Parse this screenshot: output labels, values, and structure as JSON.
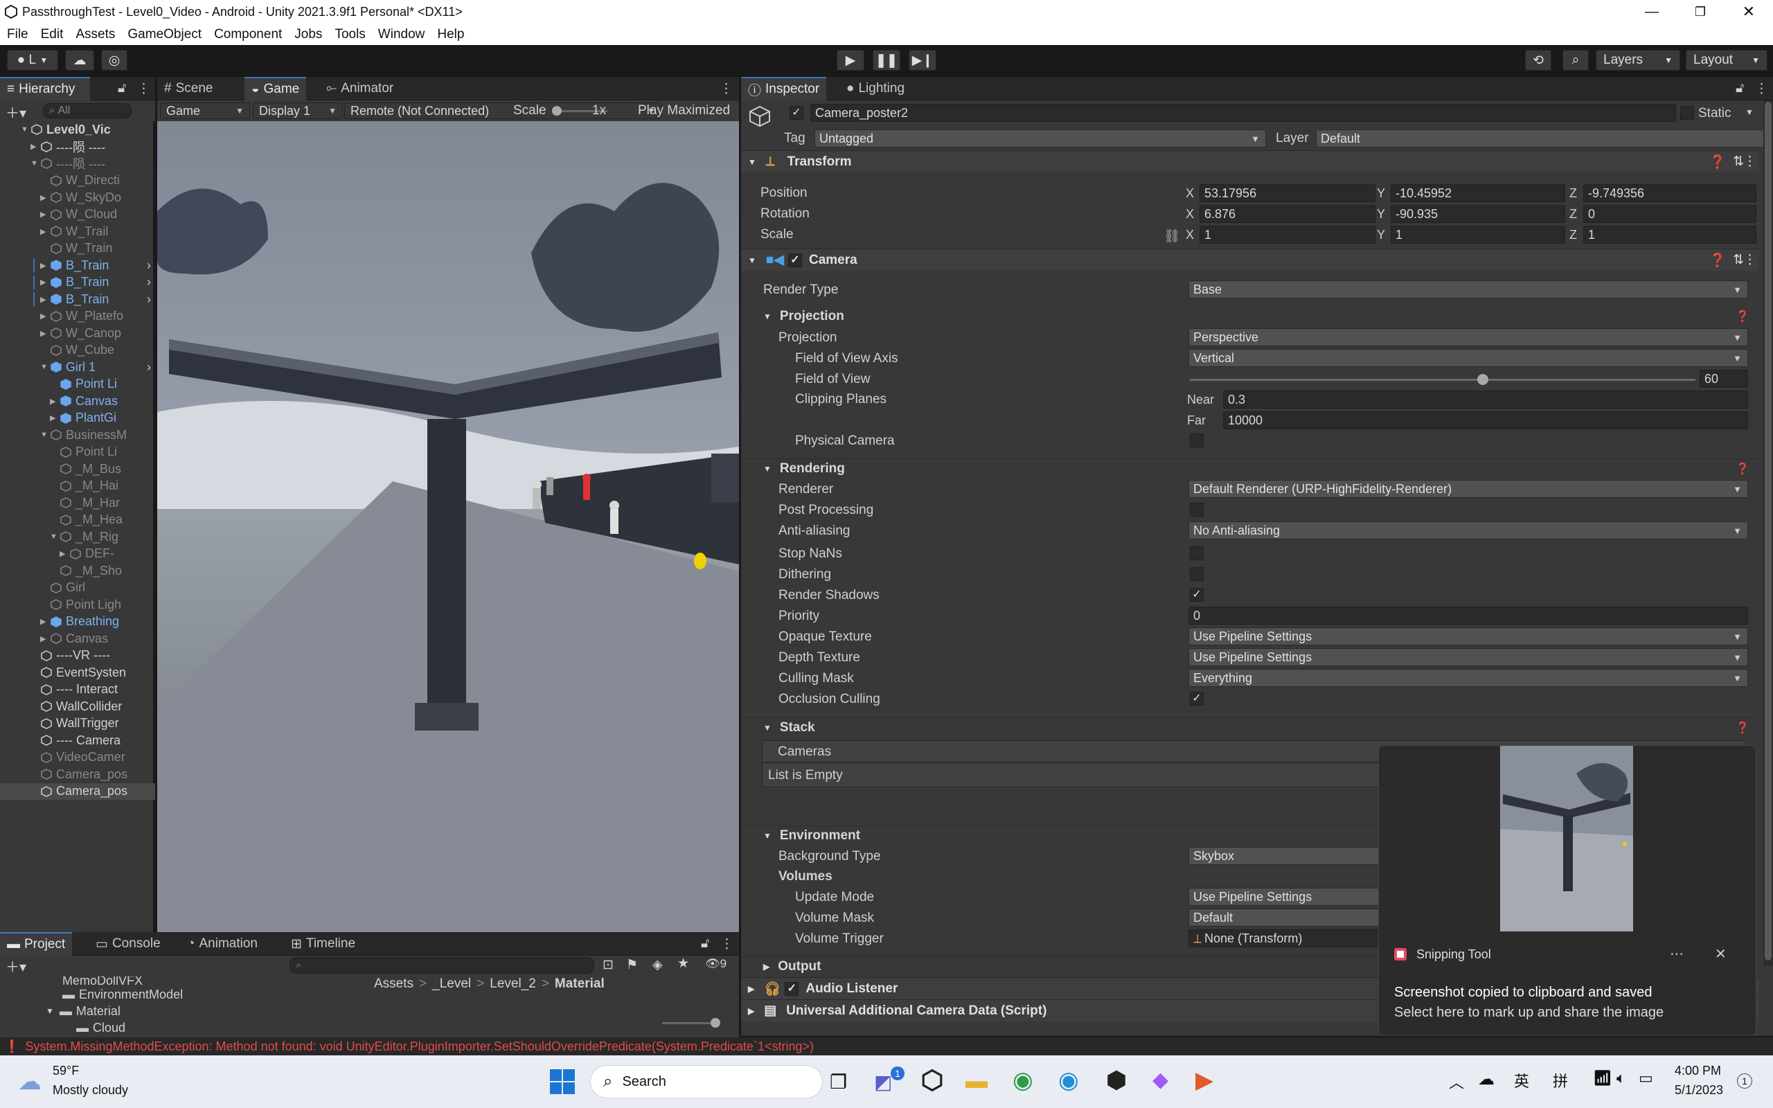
{
  "window": {
    "title": "PassthroughTest - Level0_Video - Android - Unity 2021.3.9f1 Personal* <DX11>"
  },
  "menu": [
    "File",
    "Edit",
    "Assets",
    "GameObject",
    "Component",
    "Jobs",
    "Tools",
    "Window",
    "Help"
  ],
  "toolbar": {
    "account": "L",
    "layers": "Layers",
    "layout": "Layout"
  },
  "hierarchy": {
    "tab": "Hierarchy",
    "search_placeholder": "All",
    "items": [
      {
        "label": "Level0_Vic",
        "indent": 0,
        "bold": true,
        "expand": "open"
      },
      {
        "label": "----陨 ----",
        "indent": 1,
        "expand": "closed"
      },
      {
        "label": "----陨 ----",
        "indent": 1,
        "expand": "open",
        "dim": true
      },
      {
        "label": "W_Directi",
        "indent": 2,
        "dim": true
      },
      {
        "label": "W_SkyDo",
        "indent": 2,
        "expand": "closed",
        "dim": true
      },
      {
        "label": "W_Cloud",
        "indent": 2,
        "expand": "closed",
        "dim": true
      },
      {
        "label": "W_Trail",
        "indent": 2,
        "expand": "closed",
        "dim": true
      },
      {
        "label": "W_Train",
        "indent": 2,
        "dim": true
      },
      {
        "label": "B_Train",
        "indent": 2,
        "expand": "closed",
        "blue": true,
        "arrow": true
      },
      {
        "label": "B_Train",
        "indent": 2,
        "expand": "closed",
        "blue": true,
        "arrow": true
      },
      {
        "label": "B_Train",
        "indent": 2,
        "expand": "closed",
        "blue": true,
        "arrow": true
      },
      {
        "label": "W_Platefo",
        "indent": 2,
        "expand": "closed",
        "dim": true
      },
      {
        "label": "W_Canop",
        "indent": 2,
        "expand": "closed",
        "dim": true
      },
      {
        "label": "W_Cube",
        "indent": 2,
        "dim": true
      },
      {
        "label": "Girl 1",
        "indent": 2,
        "expand": "open",
        "blue": true,
        "arrow": true
      },
      {
        "label": "Point Li",
        "indent": 3,
        "blue": true
      },
      {
        "label": "Canvas",
        "indent": 3,
        "expand": "closed",
        "blue": true
      },
      {
        "label": "PlantGi",
        "indent": 3,
        "expand": "closed",
        "blue": true
      },
      {
        "label": "BusinessM",
        "indent": 2,
        "expand": "open",
        "dim": true
      },
      {
        "label": "Point Li",
        "indent": 3,
        "dim": true
      },
      {
        "label": "_M_Bus",
        "indent": 3,
        "dim": true
      },
      {
        "label": "_M_Hai",
        "indent": 3,
        "dim": true
      },
      {
        "label": "_M_Har",
        "indent": 3,
        "dim": true
      },
      {
        "label": "_M_Hea",
        "indent": 3,
        "dim": true
      },
      {
        "label": "_M_Rig",
        "indent": 3,
        "expand": "open",
        "dim": true
      },
      {
        "label": "DEF-",
        "indent": 4,
        "expand": "closed",
        "dim": true
      },
      {
        "label": "_M_Sho",
        "indent": 3,
        "dim": true
      },
      {
        "label": "Girl",
        "indent": 2,
        "dim": true
      },
      {
        "label": "Point Ligh",
        "indent": 2,
        "dim": true
      },
      {
        "label": "Breathing",
        "indent": 2,
        "expand": "closed",
        "blue": true
      },
      {
        "label": "Canvas",
        "indent": 2,
        "expand": "closed",
        "dim": true
      },
      {
        "label": "----VR ----",
        "indent": 1
      },
      {
        "label": "EventSysten",
        "indent": 1
      },
      {
        "label": "---- Interact",
        "indent": 1
      },
      {
        "label": "WallCollider",
        "indent": 1
      },
      {
        "label": "WallTrigger",
        "indent": 1
      },
      {
        "label": "---- Camera",
        "indent": 1
      },
      {
        "label": "VideoCamer",
        "indent": 1,
        "dim": true
      },
      {
        "label": "Camera_pos",
        "indent": 1,
        "dim": true
      },
      {
        "label": "Camera_pos",
        "indent": 1,
        "selected": true
      }
    ]
  },
  "game": {
    "tabs": [
      "Scene",
      "Game",
      "Animator"
    ],
    "mode": "Game",
    "display": "Display 1",
    "remote": "Remote (Not Connected)",
    "scale_label": "Scale",
    "scale_value": "1x",
    "play": "Play Maximized"
  },
  "project": {
    "tabs": [
      "Project",
      "Console",
      "Animation",
      "Timeline"
    ],
    "tree": [
      "EnvironmentModel",
      "Material",
      "Cloud",
      "MemoDollVFX"
    ],
    "breadcrumb": [
      "Assets",
      "_Level",
      "Level_2",
      "Material"
    ],
    "hidden_count": "9"
  },
  "inspector": {
    "tabs": [
      "Inspector",
      "Lighting"
    ],
    "object_name": "Camera_poster2",
    "static_label": "Static",
    "tag_label": "Tag",
    "tag": "Untagged",
    "layer_label": "Layer",
    "layer": "Default",
    "transform": {
      "title": "Transform",
      "position": {
        "label": "Position",
        "x": "53.17956",
        "y": "-10.45952",
        "z": "-9.749356"
      },
      "rotation": {
        "label": "Rotation",
        "x": "6.876",
        "y": "-90.935",
        "z": "0"
      },
      "scale": {
        "label": "Scale",
        "x": "1",
        "y": "1",
        "z": "1"
      }
    },
    "camera": {
      "title": "Camera",
      "render_type_label": "Render Type",
      "render_type": "Base",
      "projection_header": "Projection",
      "projection_label": "Projection",
      "projection": "Perspective",
      "fov_axis_label": "Field of View Axis",
      "fov_axis": "Vertical",
      "fov_label": "Field of View",
      "fov": "60",
      "fov_fraction": 0.58,
      "clip_label": "Clipping Planes",
      "near_label": "Near",
      "near": "0.3",
      "far_label": "Far",
      "far": "10000",
      "physical_label": "Physical Camera",
      "rendering_header": "Rendering",
      "renderer_label": "Renderer",
      "renderer": "Default Renderer (URP-HighFidelity-Renderer)",
      "post_label": "Post Processing",
      "aa_label": "Anti-aliasing",
      "aa": "No Anti-aliasing",
      "nan_label": "Stop NaNs",
      "dither_label": "Dithering",
      "shadows_label": "Render Shadows",
      "priority_label": "Priority",
      "priority": "0",
      "opaque_label": "Opaque Texture",
      "opaque": "Use Pipeline Settings",
      "depth_label": "Depth Texture",
      "depth": "Use Pipeline Settings",
      "cull_label": "Culling Mask",
      "cull": "Everything",
      "occl_label": "Occlusion Culling",
      "stack_header": "Stack",
      "cameras_label": "Cameras",
      "empty": "List is Empty",
      "env_header": "Environment",
      "bg_label": "Background Type",
      "bg": "Skybox",
      "volumes_label": "Volumes",
      "update_label": "Update Mode",
      "update": "Use Pipeline Settings",
      "mask_label": "Volume Mask",
      "mask": "Default",
      "trigger_label": "Volume Trigger",
      "trigger": "None (Transform)",
      "output_header": "Output"
    },
    "audio": "Audio Listener",
    "urp": "Universal Additional Camera Data (Script)"
  },
  "toast": {
    "app": "Snipping Tool",
    "line1": "Screenshot copied to clipboard and saved",
    "line2": "Select here to mark up and share the image"
  },
  "console_error": "System.MissingMethodException: Method not found: void UnityEditor.PluginImporter.SetShouldOverridePredicate(System.Predicate`1<string>)",
  "taskbar": {
    "temp": "59°F",
    "weather": "Mostly cloudy",
    "search": "Search",
    "time": "4:00 PM",
    "date": "5/1/2023",
    "ime1": "英",
    "ime2": "拼",
    "badge": "1",
    "notif": "1"
  }
}
